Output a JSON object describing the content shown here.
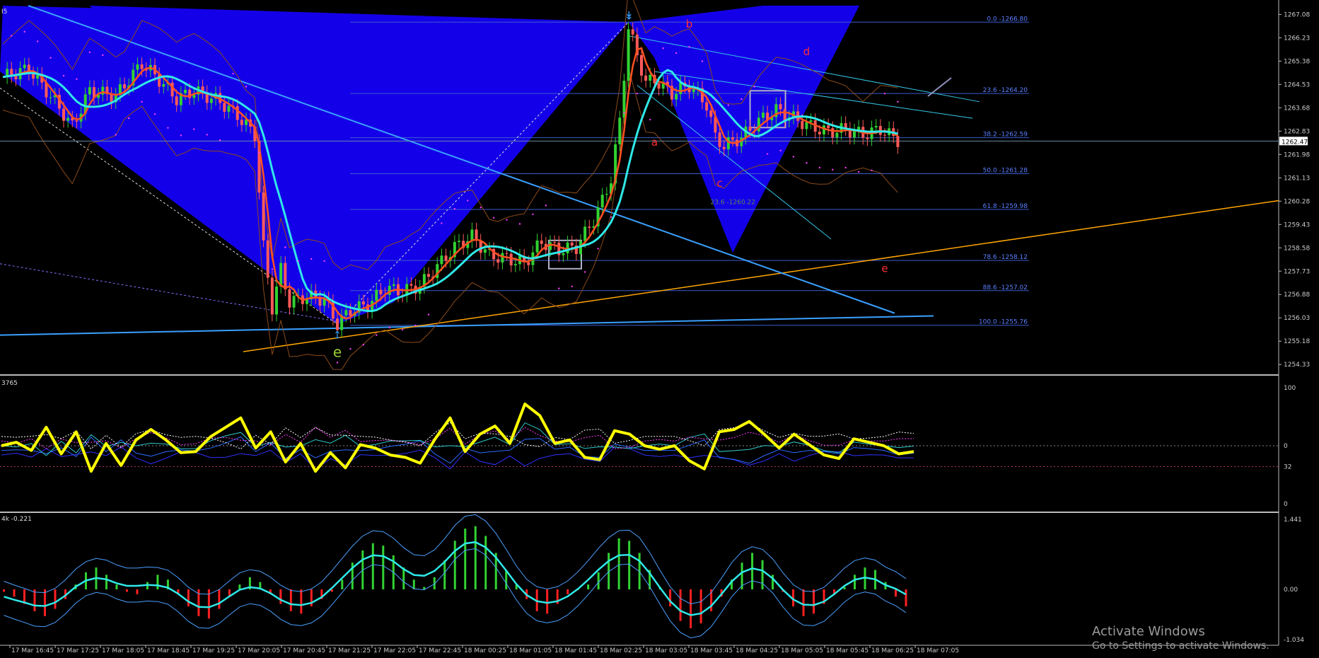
{
  "window": {
    "symbol_fragment": "I5",
    "accent_blue": "#1400e8",
    "background": "#000000"
  },
  "watermark": {
    "line1": "Activate Windows",
    "line2": "Go to Settings to activate Windows."
  },
  "chart_data": [
    {
      "type": "candlestick",
      "pane": "price",
      "title": "",
      "ylim": [
        1254.0,
        1267.4
      ],
      "y_ticks": [
        "1267.08",
        "1266.23",
        "1265.38",
        "1264.53",
        "1263.68",
        "1262.83",
        "1261.98",
        "1261.13",
        "1260.28",
        "1259.43",
        "1258.58",
        "1257.73",
        "1256.88",
        "1256.03",
        "1255.18",
        "1254.33"
      ],
      "current_price_label": "1262.47",
      "current_price": 1262.47,
      "x_ticks": [
        "17 Mar 16:45",
        "17 Mar 17:25",
        "17 Mar 18:05",
        "17 Mar 18:45",
        "17 Mar 19:25",
        "17 Mar 20:05",
        "17 Mar 20:45",
        "17 Mar 21:25",
        "17 Mar 22:05",
        "17 Mar 22:45",
        "18 Mar 00:25",
        "18 Mar 01:05",
        "18 Mar 01:45",
        "18 Mar 02:25",
        "18 Mar 03:05",
        "18 Mar 03:45",
        "18 Mar 04:25",
        "18 Mar 05:05",
        "18 Mar 05:45",
        "18 Mar 06:25",
        "18 Mar 07:05"
      ],
      "fibonacci_levels": [
        {
          "label": "0.0 -1266.80",
          "value": 1266.8
        },
        {
          "label": "23.6 -1264.20",
          "value": 1264.2
        },
        {
          "label": "38.2 -1262.59",
          "value": 1262.59
        },
        {
          "label": "50.0 -1261.28",
          "value": 1261.28
        },
        {
          "label": "61.8 -1259.98",
          "value": 1259.98
        },
        {
          "label": "78.6 -1258.12",
          "value": 1258.12
        },
        {
          "label": "88.6 -1257.02",
          "value": 1257.02
        },
        {
          "label": "100.0 -1255.76",
          "value": 1255.76
        }
      ],
      "retracement_label": {
        "label": "23.6 -1260.22",
        "value": 1260.22
      },
      "wave_labels": [
        {
          "text": "b",
          "bar": 158,
          "price": 1266.6,
          "color": "#ff3030"
        },
        {
          "text": "d",
          "bar": 185,
          "price": 1265.6,
          "color": "#ff3030"
        },
        {
          "text": "a",
          "bar": 150,
          "price": 1262.3,
          "color": "#ff3030"
        },
        {
          "text": "c",
          "bar": 165,
          "price": 1260.8,
          "color": "#ff3030"
        },
        {
          "text": "e",
          "bar": 203,
          "price": 1257.7,
          "color": "#ff3030"
        },
        {
          "text": "e",
          "bar": 77,
          "price": 1254.6,
          "color": "#9acd32"
        }
      ],
      "series_points": [
        {
          "bar": 0,
          "price": 1264.8
        },
        {
          "bar": 6,
          "price": 1265.1
        },
        {
          "bar": 12,
          "price": 1263.9
        },
        {
          "bar": 16,
          "price": 1263.0
        },
        {
          "bar": 20,
          "price": 1264.3
        },
        {
          "bar": 26,
          "price": 1264.1
        },
        {
          "bar": 32,
          "price": 1265.3
        },
        {
          "bar": 36,
          "price": 1264.7
        },
        {
          "bar": 40,
          "price": 1264.0
        },
        {
          "bar": 44,
          "price": 1264.3
        },
        {
          "bar": 50,
          "price": 1263.9
        },
        {
          "bar": 54,
          "price": 1263.4
        },
        {
          "bar": 58,
          "price": 1262.7
        },
        {
          "bar": 60,
          "price": 1258.6
        },
        {
          "bar": 62,
          "price": 1256.4
        },
        {
          "bar": 64,
          "price": 1257.8
        },
        {
          "bar": 66,
          "price": 1256.6
        },
        {
          "bar": 70,
          "price": 1256.8
        },
        {
          "bar": 74,
          "price": 1256.7
        },
        {
          "bar": 77,
          "price": 1255.8
        },
        {
          "bar": 80,
          "price": 1256.3
        },
        {
          "bar": 84,
          "price": 1256.5
        },
        {
          "bar": 88,
          "price": 1257.1
        },
        {
          "bar": 92,
          "price": 1257.0
        },
        {
          "bar": 96,
          "price": 1257.2
        },
        {
          "bar": 100,
          "price": 1257.9
        },
        {
          "bar": 104,
          "price": 1258.6
        },
        {
          "bar": 108,
          "price": 1259.0
        },
        {
          "bar": 112,
          "price": 1258.3
        },
        {
          "bar": 116,
          "price": 1258.2
        },
        {
          "bar": 120,
          "price": 1258.0
        },
        {
          "bar": 124,
          "price": 1258.8
        },
        {
          "bar": 128,
          "price": 1258.5
        },
        {
          "bar": 132,
          "price": 1258.6
        },
        {
          "bar": 136,
          "price": 1259.6
        },
        {
          "bar": 138,
          "price": 1260.3
        },
        {
          "bar": 140,
          "price": 1261.1
        },
        {
          "bar": 142,
          "price": 1263.2
        },
        {
          "bar": 144,
          "price": 1266.6
        },
        {
          "bar": 146,
          "price": 1265.6
        },
        {
          "bar": 148,
          "price": 1264.6
        },
        {
          "bar": 150,
          "price": 1264.7
        },
        {
          "bar": 154,
          "price": 1264.2
        },
        {
          "bar": 158,
          "price": 1264.5
        },
        {
          "bar": 162,
          "price": 1263.8
        },
        {
          "bar": 164,
          "price": 1262.6
        },
        {
          "bar": 166,
          "price": 1262.3
        },
        {
          "bar": 170,
          "price": 1262.6
        },
        {
          "bar": 174,
          "price": 1263.2
        },
        {
          "bar": 178,
          "price": 1263.6
        },
        {
          "bar": 182,
          "price": 1263.3
        },
        {
          "bar": 186,
          "price": 1263.0
        },
        {
          "bar": 190,
          "price": 1262.8
        },
        {
          "bar": 194,
          "price": 1262.9
        },
        {
          "bar": 198,
          "price": 1262.7
        },
        {
          "bar": 202,
          "price": 1262.9
        },
        {
          "bar": 206,
          "price": 1262.5
        }
      ]
    },
    {
      "type": "line",
      "pane": "oscillator",
      "title_fragment": "3765",
      "ylim": [
        0,
        100
      ],
      "y_ticks": [
        "100",
        "0",
        "32",
        "0"
      ],
      "levels": [
        50,
        32
      ],
      "series": [
        {
          "color": "#ffff00",
          "values": [
            50,
            53,
            46,
            66,
            43,
            62,
            28,
            52,
            33,
            55,
            64,
            55,
            44,
            45,
            58,
            66,
            74,
            48,
            62,
            36,
            52,
            28,
            44,
            31,
            51,
            48,
            42,
            40,
            35,
            56,
            74,
            45,
            60,
            67,
            52,
            86,
            76,
            52,
            55,
            40,
            38,
            63,
            60,
            50,
            47,
            50,
            37,
            30,
            62,
            64,
            71,
            60,
            48,
            60,
            51,
            42,
            39,
            56,
            53,
            50,
            43,
            45
          ]
        }
      ]
    },
    {
      "type": "bar",
      "pane": "histogram",
      "title_fragment": "4k -0.221",
      "ylim": [
        -1.034,
        1.441
      ],
      "y_ticks": [
        "1.441",
        "0.00",
        "-1.034"
      ],
      "values": [
        -0.05,
        -0.15,
        -0.3,
        -0.45,
        -0.55,
        -0.4,
        -0.2,
        0.1,
        0.35,
        0.45,
        0.3,
        0.1,
        -0.05,
        -0.1,
        0.15,
        0.3,
        0.2,
        -0.1,
        -0.35,
        -0.55,
        -0.6,
        -0.4,
        -0.15,
        0.1,
        0.25,
        0.15,
        -0.1,
        -0.3,
        -0.45,
        -0.5,
        -0.35,
        -0.2,
        -0.05,
        0.2,
        0.55,
        0.8,
        0.95,
        0.9,
        0.7,
        0.45,
        0.2,
        0.05,
        0.25,
        0.6,
        1.0,
        1.25,
        1.3,
        1.1,
        0.75,
        0.4,
        0.1,
        -0.2,
        -0.45,
        -0.5,
        -0.3,
        -0.1,
        0.0,
        0.1,
        0.35,
        0.75,
        1.05,
        1.0,
        0.75,
        0.4,
        0.05,
        -0.35,
        -0.65,
        -0.8,
        -0.7,
        -0.45,
        -0.15,
        0.2,
        0.55,
        0.75,
        0.6,
        0.3,
        -0.05,
        -0.35,
        -0.55,
        -0.5,
        -0.3,
        -0.1,
        0.05,
        0.3,
        0.45,
        0.4,
        0.15,
        -0.15,
        -0.35
      ]
    }
  ]
}
